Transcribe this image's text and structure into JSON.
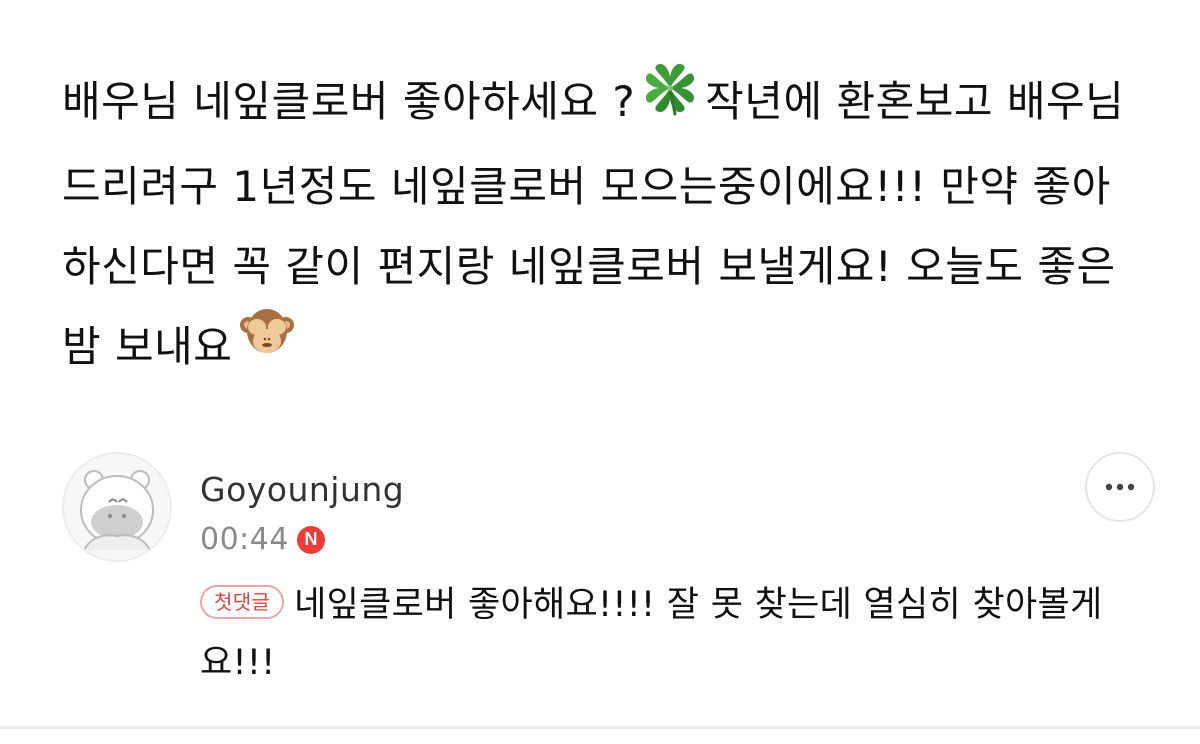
{
  "post": {
    "text_part1": "배우님 네잎클로버 좋아하세요 ?",
    "emoji_1": "four-leaf-clover",
    "text_part2": "작년에 환혼보고 배우님 드리려구 1년정도 네잎클로버 모으는중이에요!!! 만약 좋아하신다면 꼭 같이 편지랑 네잎클로버 보낼게요! 오늘도 좋은 밤 보내요",
    "emoji_2": "see-no-evil-monkey"
  },
  "comment": {
    "author": "Goyounjung",
    "time": "00:44",
    "badge_n": "N",
    "first_comment_badge": "첫댓글",
    "text": "네잎클로버 좋아해요!!!! 잘 못 찾는데 열심히 찾아볼게요!!!",
    "more_icon": "more-horizontal-icon"
  },
  "colors": {
    "text": "#111111",
    "author": "#333333",
    "time": "#8a8a8a",
    "badge_red": "#ef3b36",
    "first_badge_text": "#e8413c",
    "first_badge_border": "#f3a3a3"
  }
}
